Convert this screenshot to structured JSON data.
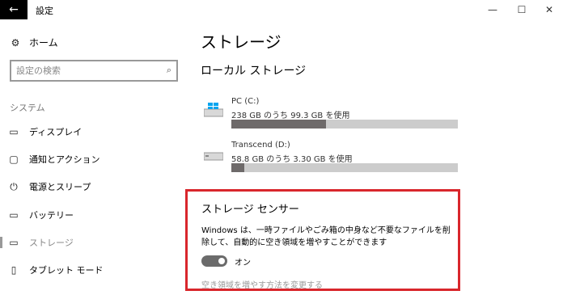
{
  "window": {
    "title": "設定",
    "back_icon": "←",
    "minimize_icon": "—",
    "maximize_icon": "☐",
    "close_icon": "✕"
  },
  "sidebar": {
    "home": {
      "icon": "⚙",
      "label": "ホーム"
    },
    "search": {
      "placeholder": "設定の検索",
      "icon": "⌕"
    },
    "section_label": "システム",
    "items": [
      {
        "icon": "▭",
        "label": "ディスプレイ"
      },
      {
        "icon": "▢",
        "label": "通知とアクション"
      },
      {
        "icon": "⏻",
        "label": "電源とスリープ"
      },
      {
        "icon": "▭",
        "label": "バッテリー"
      },
      {
        "icon": "▭",
        "label": "ストレージ",
        "active": true
      },
      {
        "icon": "▯",
        "label": "タブレット モード"
      }
    ]
  },
  "main": {
    "title": "ストレージ",
    "section_title": "ローカル ストレージ",
    "drives": [
      {
        "name": "PC (C:)",
        "usage": "238 GB のうち 99.3 GB を使用",
        "used_fraction": 0.417,
        "icon": "windows-drive-icon"
      },
      {
        "name": "Transcend (D:)",
        "usage": "58.8 GB のうち 3.30 GB を使用",
        "used_fraction": 0.056,
        "icon": "drive-icon"
      }
    ],
    "storage_sense": {
      "title": "ストレージ センサー",
      "description": "Windows は、一時ファイルやごみ箱の中身など不要なファイルを削除して、自動的に空き領域を増やすことができます",
      "toggle_state": "オン",
      "link": "空き領域を増やす方法を変更する"
    }
  },
  "colors": {
    "highlight_border": "#d9262c",
    "bar_used": "#6e6a6a",
    "bar_track": "#cccccc",
    "windows_blue": "#00a4ef"
  }
}
